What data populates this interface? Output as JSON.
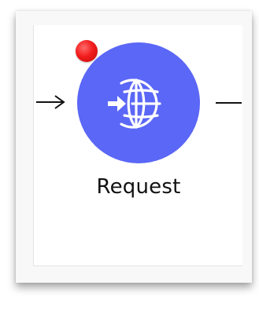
{
  "node": {
    "label": "Request",
    "icon": "globe-enter-icon",
    "color": "#5b67f6",
    "status_color": "#f21d1d"
  },
  "connectors": {
    "incoming": "arrow-right",
    "outgoing": "line"
  }
}
